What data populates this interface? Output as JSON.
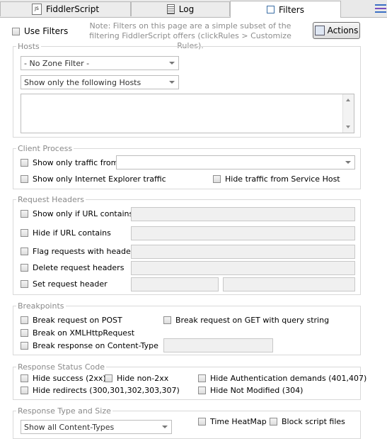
{
  "tabs": [
    {
      "label": "FiddlerScript",
      "icon": "js-file-icon"
    },
    {
      "label": "Log",
      "icon": "log-document-icon"
    },
    {
      "label": "Filters",
      "icon": "filter-checkbox-icon",
      "active": true
    }
  ],
  "top": {
    "use_filters_label": "Use Filters",
    "note": "Note: Filters on this page are a simple subset of the filtering FiddlerScript offers (clickRules > Customize Rules).",
    "actions_label": "Actions"
  },
  "hosts": {
    "title": "Hosts",
    "zone_filter": "- No Zone Filter -",
    "host_filter": "Show only the following Hosts",
    "host_list": ""
  },
  "client_process": {
    "title": "Client Process",
    "show_only_traffic_from": "Show only traffic from",
    "process_value": "",
    "show_ie_only": "Show only Internet Explorer traffic",
    "hide_service_host": "Hide traffic from Service Host"
  },
  "request_headers": {
    "title": "Request Headers",
    "show_if_url": "Show only if URL contains",
    "hide_if_url": "Hide if URL contains",
    "flag_headers": "Flag requests with headers",
    "delete_headers": "Delete request headers",
    "set_header": "Set request header"
  },
  "breakpoints": {
    "title": "Breakpoints",
    "break_post": "Break request on POST",
    "break_get_query": "Break request on GET with query string",
    "break_xhr": "Break on XMLHttpRequest",
    "break_content_type": "Break response on Content-Type"
  },
  "response_status": {
    "title": "Response Status Code",
    "hide_success": "Hide success (2xx)",
    "hide_non2xx": "Hide non-2xx",
    "hide_auth": "Hide Authentication demands (401,407)",
    "hide_redirects": "Hide redirects (300,301,302,303,307)",
    "hide_not_modified": "Hide Not Modified (304)"
  },
  "response_type": {
    "title": "Response Type and Size",
    "content_types": "Show all Content-Types",
    "time_heatmap": "Time HeatMap",
    "block_script": "Block script files"
  }
}
